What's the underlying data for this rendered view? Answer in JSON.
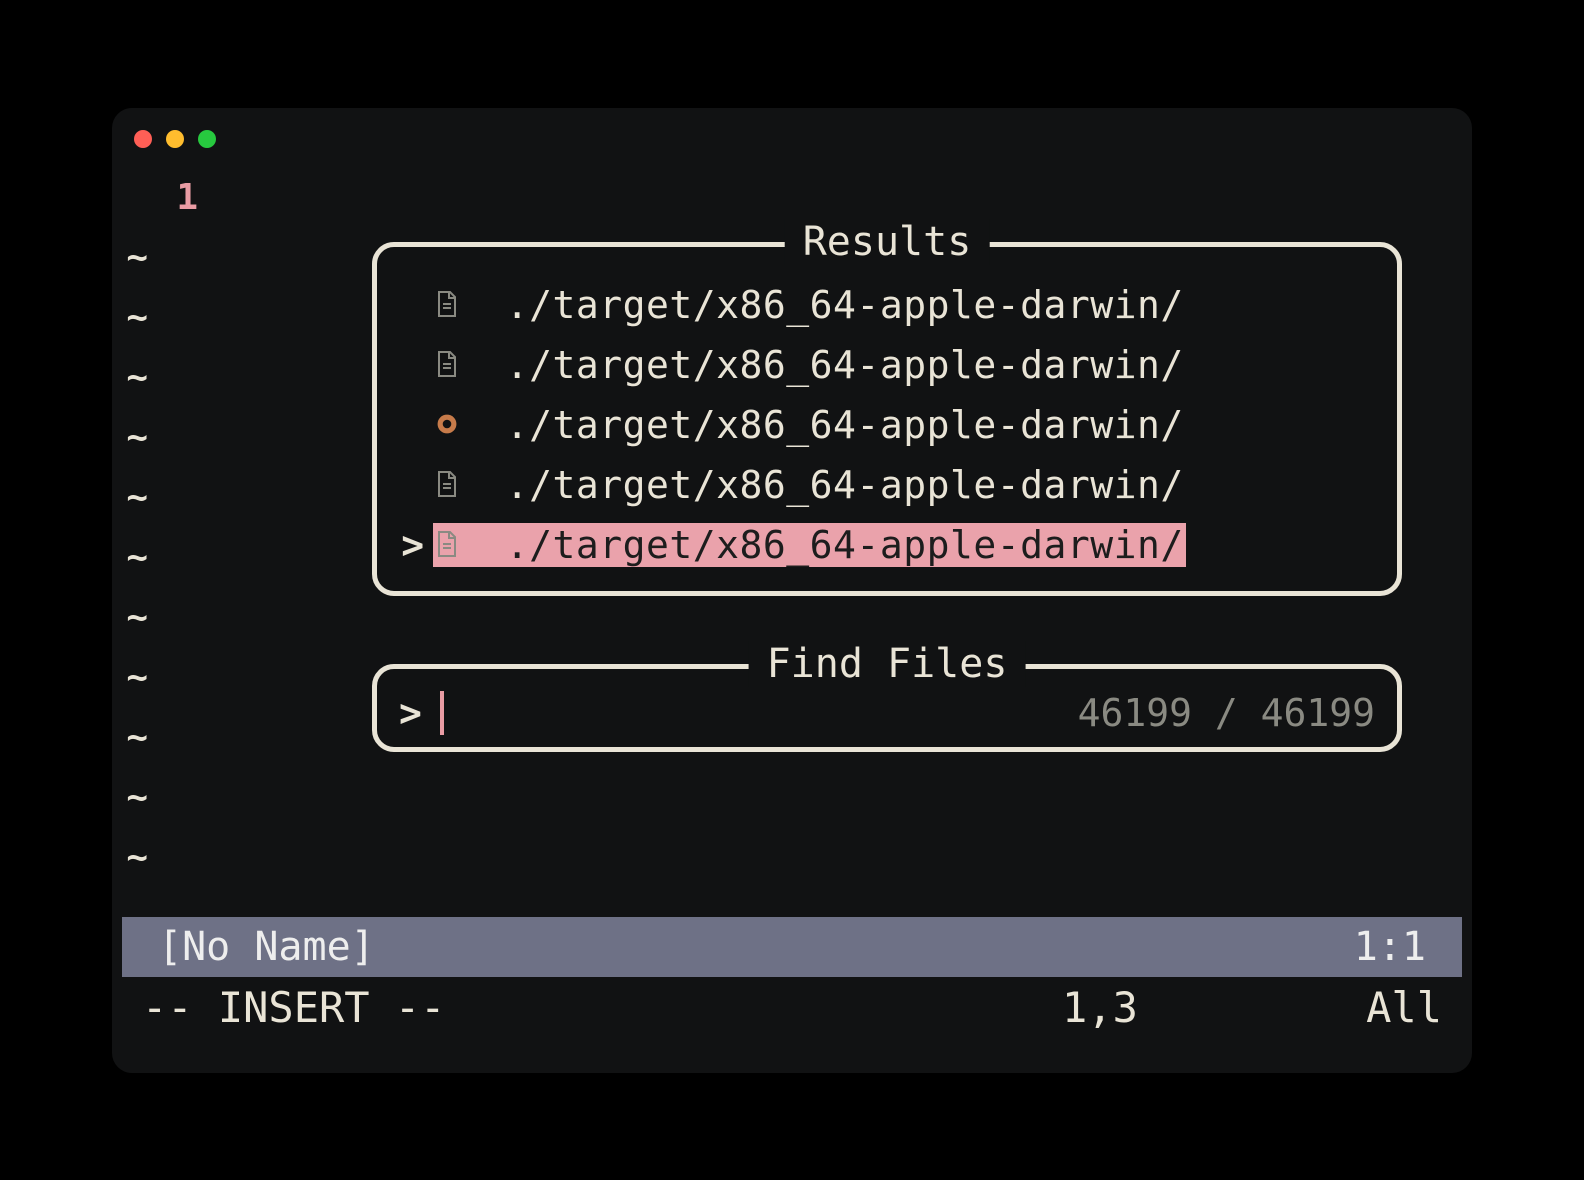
{
  "gutter": {
    "lineno": "1",
    "tilde_count": 11
  },
  "results": {
    "title": "Results",
    "items": [
      {
        "icon": "file",
        "path": "./target/x86_64-apple-darwin/",
        "selected": false
      },
      {
        "icon": "file",
        "path": "./target/x86_64-apple-darwin/",
        "selected": false
      },
      {
        "icon": "rust",
        "path": "./target/x86_64-apple-darwin/",
        "selected": false
      },
      {
        "icon": "file",
        "path": "./target/x86_64-apple-darwin/",
        "selected": false
      },
      {
        "icon": "file",
        "path": "./target/x86_64-apple-darwin/",
        "selected": true
      }
    ],
    "pointer_glyph": ">"
  },
  "find": {
    "title": "Find Files",
    "prompt": ">",
    "input_value": "",
    "count_text": "46199 / 46199"
  },
  "statusbar": {
    "left": "[No Name]",
    "right": "1:1"
  },
  "modeline": {
    "left": "-- INSERT --",
    "center": "1,3",
    "right": "All"
  },
  "icons": {
    "file_color": "#8a8a82",
    "rust_color": "#c77b4a"
  }
}
